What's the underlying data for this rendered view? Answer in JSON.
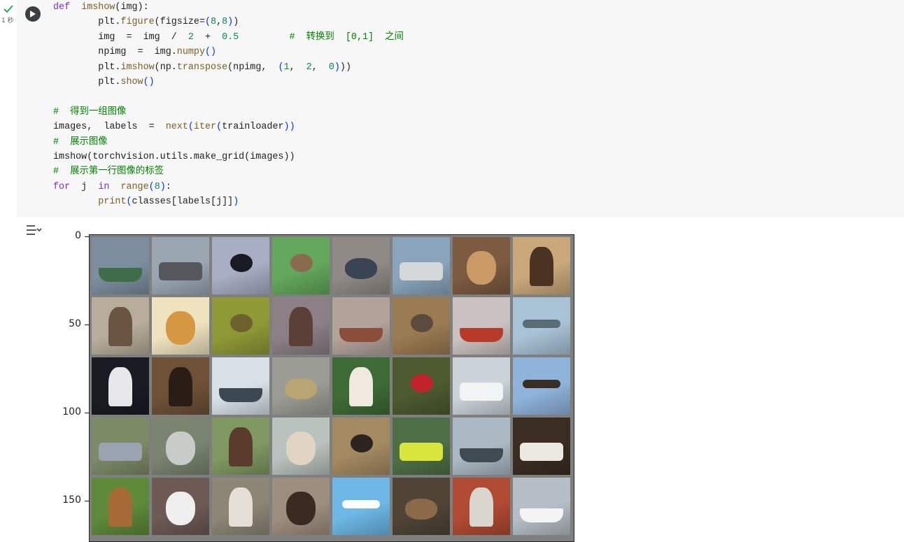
{
  "cell": {
    "status": "check",
    "exec_time": "1 秒",
    "code_lines": [
      [
        [
          "kw",
          "def"
        ],
        [
          "t",
          "  "
        ],
        [
          "fn",
          "imshow"
        ],
        [
          "t",
          "(img):"
        ]
      ],
      [
        [
          "t",
          "        plt."
        ],
        [
          "fn",
          "figure"
        ],
        [
          "t",
          "(figsize="
        ],
        [
          "pn",
          "("
        ],
        [
          "num",
          "8"
        ],
        [
          "t",
          ","
        ],
        [
          "num",
          "8"
        ],
        [
          "pn",
          ")"
        ],
        [
          "t",
          ")"
        ]
      ],
      [
        [
          "t",
          "        img  =  img  /  "
        ],
        [
          "num",
          "2"
        ],
        [
          "t",
          "  +  "
        ],
        [
          "num",
          "0.5"
        ],
        [
          "t",
          "         "
        ],
        [
          "cm",
          "#  转换到  [0,1]  之间"
        ]
      ],
      [
        [
          "t",
          "        npimg  =  img."
        ],
        [
          "fn",
          "numpy"
        ],
        [
          "pn",
          "()"
        ]
      ],
      [
        [
          "t",
          "        plt."
        ],
        [
          "fn",
          "imshow"
        ],
        [
          "t",
          "(np."
        ],
        [
          "fn",
          "transpose"
        ],
        [
          "t",
          "(npimg,  "
        ],
        [
          "pn",
          "("
        ],
        [
          "num",
          "1"
        ],
        [
          "t",
          ",  "
        ],
        [
          "num",
          "2"
        ],
        [
          "t",
          ",  "
        ],
        [
          "num",
          "0"
        ],
        [
          "pn",
          ")"
        ],
        [
          "t",
          "))"
        ]
      ],
      [
        [
          "t",
          "        plt."
        ],
        [
          "fn",
          "show"
        ],
        [
          "pn",
          "()"
        ]
      ],
      [
        [
          "t",
          ""
        ]
      ],
      [
        [
          "cm",
          "#  得到一组图像"
        ]
      ],
      [
        [
          "t",
          "images,  labels  =  "
        ],
        [
          "fn",
          "next"
        ],
        [
          "pn",
          "("
        ],
        [
          "fn",
          "iter"
        ],
        [
          "pn",
          "("
        ],
        [
          "t",
          "trainloader"
        ],
        [
          "pn",
          "))"
        ]
      ],
      [
        [
          "cm",
          "#  展示图像"
        ]
      ],
      [
        [
          "t",
          "imshow(torchvision.utils.make_grid(images))"
        ]
      ],
      [
        [
          "cm",
          "#  展示第一行图像的标签"
        ]
      ],
      [
        [
          "kw",
          "for"
        ],
        [
          "t",
          "  j  "
        ],
        [
          "kw",
          "in"
        ],
        [
          "t",
          "  "
        ],
        [
          "fn",
          "range"
        ],
        [
          "pn",
          "("
        ],
        [
          "num",
          "8"
        ],
        [
          "pn",
          ")"
        ],
        [
          "t",
          ":"
        ]
      ],
      [
        [
          "t",
          "        "
        ],
        [
          "fn",
          "print"
        ],
        [
          "pn",
          "("
        ],
        [
          "t",
          "classes[labels[j]]"
        ],
        [
          "pn",
          ")"
        ]
      ]
    ]
  },
  "output": {
    "icon": "output-settings-icon",
    "yticks": [
      "0",
      "50",
      "100",
      "150"
    ],
    "image_grid": {
      "columns": 8,
      "thumbnails": [
        {
          "subject": "ship",
          "bg": "#7c8e9e",
          "fg": "#3f6d4a"
        },
        {
          "subject": "truck",
          "bg": "#9aa7b3",
          "fg": "#55575c"
        },
        {
          "subject": "bird",
          "bg": "#a8aec4",
          "fg": "#1a1a22"
        },
        {
          "subject": "bird",
          "bg": "#63a85c",
          "fg": "#8b6b4e"
        },
        {
          "subject": "frog",
          "bg": "#8f8a86",
          "fg": "#3a4454"
        },
        {
          "subject": "truck",
          "bg": "#8aa5bb",
          "fg": "#d5d8d9"
        },
        {
          "subject": "dog",
          "bg": "#7c5b40",
          "fg": "#c99a66"
        },
        {
          "subject": "horse",
          "bg": "#caa87a",
          "fg": "#4a3322"
        },
        {
          "subject": "deer",
          "bg": "#b8ad9a",
          "fg": "#6a5442"
        },
        {
          "subject": "dog",
          "bg": "#efe3bf",
          "fg": "#d69743"
        },
        {
          "subject": "bird",
          "bg": "#8f9a36",
          "fg": "#6e6130"
        },
        {
          "subject": "deer",
          "bg": "#8c7f86",
          "fg": "#5a4036"
        },
        {
          "subject": "ship",
          "bg": "#b3a29a",
          "fg": "#8a4e3a"
        },
        {
          "subject": "bird",
          "bg": "#9b7b52",
          "fg": "#5b4a3e"
        },
        {
          "subject": "ship",
          "bg": "#c9c2c0",
          "fg": "#b83b2a"
        },
        {
          "subject": "airplane",
          "bg": "#a9c3d6",
          "fg": "#5a6d75"
        },
        {
          "subject": "horse",
          "bg": "#1a1c24",
          "fg": "#e8e8ea"
        },
        {
          "subject": "horse",
          "bg": "#6e5137",
          "fg": "#2a1d15"
        },
        {
          "subject": "ship",
          "bg": "#d7e0e6",
          "fg": "#3c4952"
        },
        {
          "subject": "frog",
          "bg": "#9b9d94",
          "fg": "#b8a573"
        },
        {
          "subject": "horse",
          "bg": "#3e6b35",
          "fg": "#efe9df"
        },
        {
          "subject": "bird",
          "bg": "#4d5a2f",
          "fg": "#c2232b"
        },
        {
          "subject": "automobile",
          "bg": "#c9d3d8",
          "fg": "#f1f3f4"
        },
        {
          "subject": "airplane",
          "bg": "#8fb4dc",
          "fg": "#3a2d24"
        },
        {
          "subject": "automobile",
          "bg": "#7d8a66",
          "fg": "#9aa3b2"
        },
        {
          "subject": "cat",
          "bg": "#7a8470",
          "fg": "#c9cbc9"
        },
        {
          "subject": "deer",
          "bg": "#809861",
          "fg": "#5a3b2c"
        },
        {
          "subject": "cat",
          "bg": "#b9c2bc",
          "fg": "#e0d4c2"
        },
        {
          "subject": "bird",
          "bg": "#a48a62",
          "fg": "#2b2420"
        },
        {
          "subject": "automobile",
          "bg": "#4e6f46",
          "fg": "#d9e53a"
        },
        {
          "subject": "ship",
          "bg": "#aab9c4",
          "fg": "#404a52"
        },
        {
          "subject": "truck",
          "bg": "#3b2d22",
          "fg": "#ece9e3"
        },
        {
          "subject": "deer",
          "bg": "#5e8a3a",
          "fg": "#a56a36"
        },
        {
          "subject": "dog",
          "bg": "#6d5a55",
          "fg": "#efefef"
        },
        {
          "subject": "horse",
          "bg": "#8b8676",
          "fg": "#e4e0d8"
        },
        {
          "subject": "cat",
          "bg": "#9e8e7e",
          "fg": "#3b2a22"
        },
        {
          "subject": "airplane",
          "bg": "#6db8e6",
          "fg": "#ffffff"
        },
        {
          "subject": "frog",
          "bg": "#4f4436",
          "fg": "#8a6a48"
        },
        {
          "subject": "horse",
          "bg": "#b04a32",
          "fg": "#d9d6d0"
        },
        {
          "subject": "ship",
          "bg": "#b5bec6",
          "fg": "#f4f4f4"
        }
      ]
    }
  }
}
